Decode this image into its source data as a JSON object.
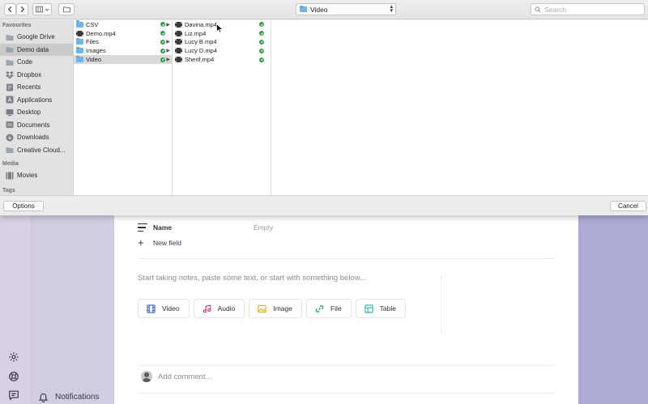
{
  "dialog": {
    "path_popup": {
      "label": "Video"
    },
    "search": {
      "placeholder": "Search"
    },
    "sidebar": {
      "favourites_header": "Favourites",
      "favourites": [
        {
          "label": "Google Drive",
          "icon": "folder-icon"
        },
        {
          "label": "Demo data",
          "icon": "folder-icon"
        },
        {
          "label": "Code",
          "icon": "folder-icon"
        },
        {
          "label": "Dropbox",
          "icon": "dropbox-icon"
        },
        {
          "label": "Recents",
          "icon": "recents-icon"
        },
        {
          "label": "Applications",
          "icon": "applications-icon"
        },
        {
          "label": "Desktop",
          "icon": "desktop-icon"
        },
        {
          "label": "Documents",
          "icon": "documents-icon"
        },
        {
          "label": "Downloads",
          "icon": "downloads-icon"
        },
        {
          "label": "Creative Cloud...",
          "icon": "folder-icon"
        }
      ],
      "media_header": "Media",
      "media": [
        {
          "label": "Movies",
          "icon": "movies-icon"
        }
      ],
      "tags_header": "Tags"
    },
    "column1": [
      {
        "name": "CSV",
        "type": "folder"
      },
      {
        "name": "Demo.mp4",
        "type": "video"
      },
      {
        "name": "Files",
        "type": "folder"
      },
      {
        "name": "Images",
        "type": "folder"
      },
      {
        "name": "Video",
        "type": "folder"
      }
    ],
    "column2": [
      {
        "name": "Davina.mp4"
      },
      {
        "name": "Liz.mp4"
      },
      {
        "name": "Lucy B.mp4"
      },
      {
        "name": "Lucy D.mp4"
      },
      {
        "name": "Sherif.mp4"
      }
    ],
    "options_label": "Options",
    "cancel_label": "Cancel"
  },
  "page": {
    "property_name": "Name",
    "property_value": "Empty",
    "new_field": "New field",
    "notes_placeholder": "Start taking notes, paste some text, or start with something below...",
    "blocks": [
      {
        "label": "Video",
        "icon": "video-icon",
        "color": "#3d63c9"
      },
      {
        "label": "Audio",
        "icon": "audio-icon",
        "color": "#d6336c"
      },
      {
        "label": "Image",
        "icon": "image-icon",
        "color": "#e0a80d"
      },
      {
        "label": "File",
        "icon": "link-icon",
        "color": "#1a9c7a"
      },
      {
        "label": "Table",
        "icon": "table-icon",
        "color": "#1fb5a8"
      }
    ],
    "comment_placeholder": "Add comment...",
    "notifications": "Notifications"
  }
}
